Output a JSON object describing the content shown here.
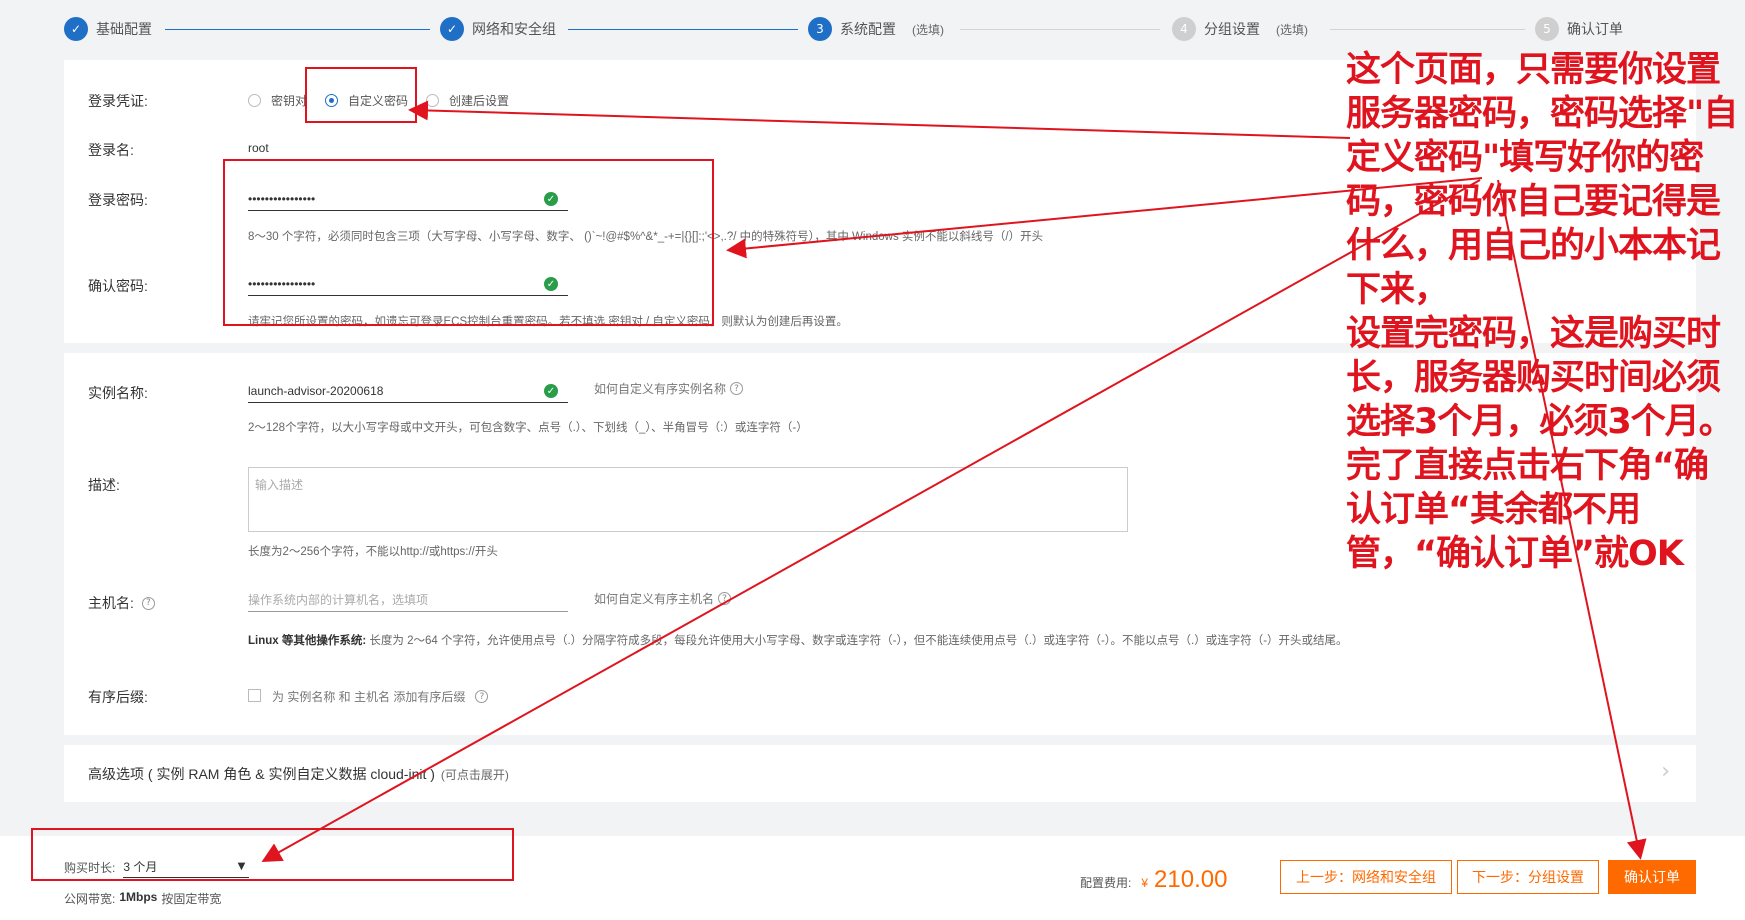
{
  "steps": [
    {
      "num": "✓",
      "label": "基础配置",
      "sub": ""
    },
    {
      "num": "✓",
      "label": "网络和安全组",
      "sub": ""
    },
    {
      "num": "3",
      "label": "系统配置",
      "sub": "(选填)"
    },
    {
      "num": "4",
      "label": "分组设置",
      "sub": "(选填)"
    },
    {
      "num": "5",
      "label": "确认订单",
      "sub": ""
    }
  ],
  "login": {
    "credential_label": "登录凭证:",
    "options": [
      "密钥对",
      "自定义密码",
      "创建后设置"
    ],
    "username_label": "登录名:",
    "username_value": "root",
    "password_label": "登录密码:",
    "password_value": "••••••••••••••••",
    "password_hint": "8～30 个字符，必须同时包含三项（大写字母、小写字母、数字、 ()`~!@#$%^&*_-+=|{}[]:;'<>,.?/ 中的特殊符号），其中 Windows 实例不能以斜线号（/）开头",
    "confirm_label": "确认密码:",
    "confirm_value": "••••••••••••••••",
    "confirm_hint": "请牢记您所设置的密码，如遗忘可登录ECS控制台重置密码。若不填选 密钥对 / 自定义密码，则默认为创建后再设置。"
  },
  "instance": {
    "name_label": "实例名称:",
    "name_value": "launch-advisor-20200618",
    "name_help": "如何自定义有序实例名称",
    "name_hint": "2～128个字符，以大小写字母或中文开头，可包含数字、点号（.）、下划线（_）、半角冒号（:）或连字符（-）",
    "desc_label": "描述:",
    "desc_placeholder": "输入描述",
    "desc_hint": "长度为2～256个字符，不能以http://或https://开头",
    "host_label": "主机名:",
    "host_placeholder": "操作系统内部的计算机名，选填项",
    "host_help": "如何自定义有序主机名",
    "host_hint_bold": "Linux 等其他操作系统:",
    "host_hint": " 长度为 2～64 个字符，允许使用点号（.）分隔字符成多段，每段允许使用大小写字母、数字或连字符（-），但不能连续使用点号（.）或连字符（-）。不能以点号（.）或连字符（-）开头或结尾。",
    "suffix_label": "有序后缀:",
    "suffix_text": "为 实例名称 和 主机名 添加有序后缀"
  },
  "advanced": {
    "title": "高级选项 ( 实例 RAM 角色 & 实例自定义数据 cloud-init )",
    "sub": "(可点击展开)"
  },
  "footer": {
    "duration_label": "购买时长:",
    "duration_value": "3 个月",
    "bandwidth_label": "公网带宽:",
    "bandwidth_value": "1Mbps",
    "bandwidth_note": "按固定带宽",
    "fee_label": "配置费用:",
    "fee_currency": "¥",
    "fee_value": "210.00",
    "prev_button": "上一步：网络和安全组",
    "next_button": "下一步：分组设置",
    "confirm_button": "确认订单"
  },
  "annotation": "这个页面，只需要你设置服务器密码，密码选择\"自定义密码\"填写好你的密码，密码你自己要记得是什么，用自己的小本本记下来，\n设置完密码，这是购买时长，服务器购买时间必须选择3个月，必须3个月。完了直接点击右下角“确认订单“其余都不用管，“确认订单”就OK",
  "colors": {
    "accent": "#1f6fc7",
    "orange": "#ff6a00",
    "annotation_red": "#e0141e"
  }
}
